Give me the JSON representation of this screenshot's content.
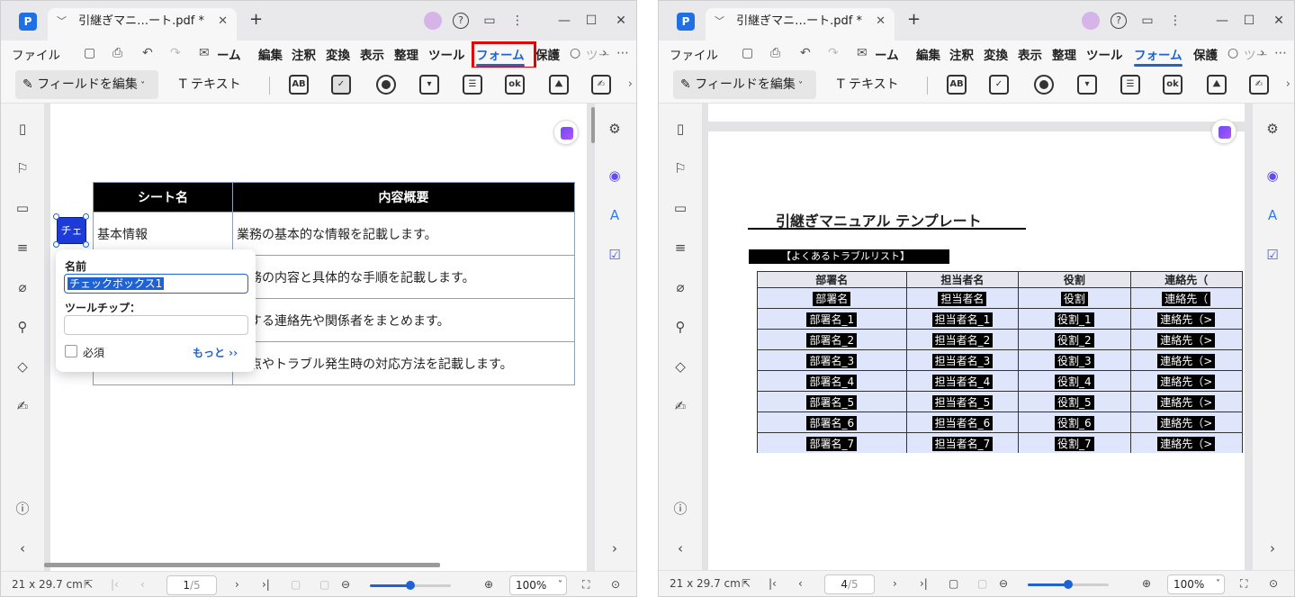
{
  "left": {
    "tab_title": "引継ぎマニ…ート.pdf *",
    "menu": [
      "ファイル",
      "ーム",
      "編集",
      "注釈",
      "変換",
      "表示",
      "整理",
      "ツール",
      "フォーム",
      "保護",
      "ツー"
    ],
    "toolbar": {
      "edit_field": "フィールドを編集",
      "text": "テキスト",
      "ab": "AB",
      "ok": "ok"
    },
    "table": {
      "headers": [
        "シート名",
        "内容概要"
      ],
      "rows": [
        [
          "基本情報",
          "業務の基本的な情報を記載します。"
        ],
        [
          "",
          "業務の内容と具体的な手順を記載します。"
        ],
        [
          "",
          "連する連絡先や関係者をまとめます。"
        ],
        [
          "",
          "意点やトラブル発生時の対応方法を記載します。"
        ]
      ]
    },
    "checkbox_field_label": "チェ",
    "popover": {
      "name_label": "名前",
      "name_value": "チェックボックス1",
      "tooltip_label": "ツールチップ：",
      "tooltip_value": "",
      "required_label": "必須",
      "more_label": "もっと ››"
    },
    "status": {
      "page_size": "21 x 29.7 cm",
      "page": "1",
      "total": "/5",
      "zoom": "100%",
      "zoom_level": 0.5
    }
  },
  "right": {
    "tab_title": "引継ぎマニ…ート.pdf *",
    "menu": [
      "ファイル",
      "ーム",
      "編集",
      "注釈",
      "変換",
      "表示",
      "整理",
      "ツール",
      "フォーム",
      "保護",
      "ツー"
    ],
    "toolbar": {
      "edit_field": "フィールドを編集",
      "text": "テキスト",
      "ab": "AB",
      "ok": "ok"
    },
    "doc_title": "引継ぎマニュアル テンプレート",
    "section": "【よくあるトラブルリスト】",
    "table": {
      "headers": [
        "部署名",
        "担当者名",
        "役割",
        "連絡先（"
      ],
      "rows": [
        [
          "部署名",
          "担当者名",
          "役割",
          "連絡先（"
        ],
        [
          "部署名_1",
          "担当者名_1",
          "役割_1",
          "連絡先（>"
        ],
        [
          "部署名_2",
          "担当者名_2",
          "役割_2",
          "連絡先（>"
        ],
        [
          "部署名_3",
          "担当者名_3",
          "役割_3",
          "連絡先（>"
        ],
        [
          "部署名_4",
          "担当者名_4",
          "役割_4",
          "連絡先（>"
        ],
        [
          "部署名_5",
          "担当者名_5",
          "役割_5",
          "連絡先（>"
        ],
        [
          "部署名_6",
          "担当者名_6",
          "役割_6",
          "連絡先（>"
        ],
        [
          "部署名_7",
          "担当者名_7",
          "役割_7",
          "連絡先（>"
        ]
      ]
    },
    "status": {
      "page_size": "21 x 29.7 cm",
      "page": "4",
      "total": "/5",
      "zoom": "100%",
      "zoom_level": 0.5
    }
  }
}
